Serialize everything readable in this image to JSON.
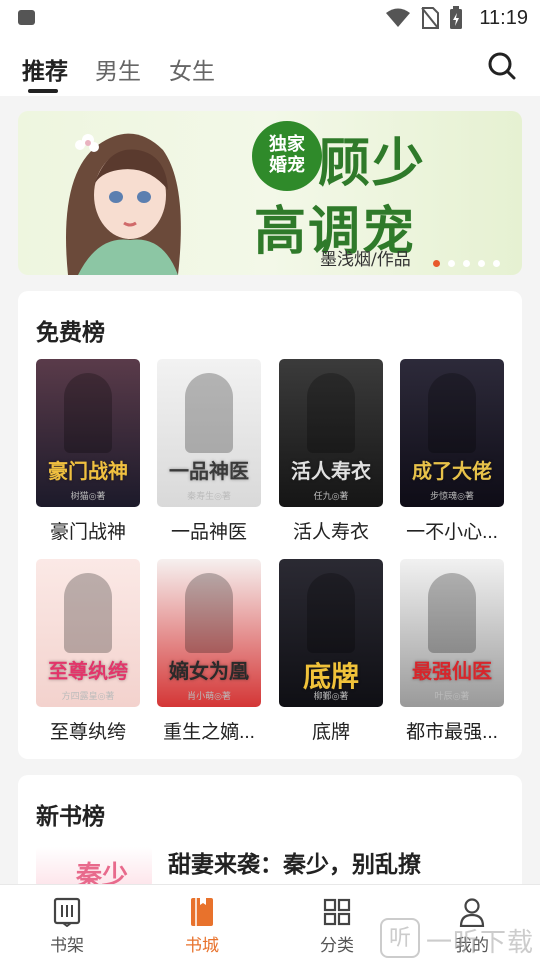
{
  "status_bar": {
    "time": "11:19"
  },
  "top_nav": {
    "tabs": [
      {
        "label": "推荐",
        "active": true
      },
      {
        "label": "男生",
        "active": false
      },
      {
        "label": "女生",
        "active": false
      }
    ]
  },
  "banner": {
    "badge": "独家\n婚宠",
    "title_line1": "顾少",
    "title_line2": "高调宠",
    "author": "墨浅烟/作品"
  },
  "free_rank": {
    "title": "免费榜",
    "books": [
      {
        "name": "豪门战神",
        "cover_text": "豪门战神",
        "cover_author": "树猫◎著",
        "colors": [
          "#5a3b4a",
          "#1c1a2a"
        ],
        "accent": "#f0c040"
      },
      {
        "name": "一品神医",
        "cover_text": "一品神医",
        "cover_author": "秦寿生◎著",
        "colors": [
          "#f2f2f2",
          "#d9d9d9"
        ],
        "accent": "#3a3a3a"
      },
      {
        "name": "活人寿衣",
        "cover_text": "活人寿衣",
        "cover_author": "任九◎著",
        "colors": [
          "#3b3b3b",
          "#151515"
        ],
        "accent": "#e0e0e0"
      },
      {
        "name": "一不小心...",
        "cover_text": "成了大佬",
        "cover_author": "步惊魂◎著",
        "colors": [
          "#2d2a3a",
          "#0e0c16"
        ],
        "accent": "#e8c24a"
      },
      {
        "name": "至尊纨绔",
        "cover_text": "至尊纨绔",
        "cover_author": "方四露皇◎著",
        "colors": [
          "#fbe9e6",
          "#f3d2cd"
        ],
        "accent": "#e2356a"
      },
      {
        "name": "重生之嫡...",
        "cover_text": "嫡女为凰",
        "cover_author": "肖小萌◎著",
        "colors": [
          "#f6f0ef",
          "#d43636"
        ],
        "accent": "#2a2a2a"
      },
      {
        "name": "底牌",
        "cover_text": "底牌",
        "cover_author": "柳鄞◎著",
        "colors": [
          "#2b2a33",
          "#0f0f14"
        ],
        "accent": "#f0c23a"
      },
      {
        "name": "都市最强...",
        "cover_text": "最强仙医",
        "cover_author": "叶辰◎著",
        "colors": [
          "#f1f1f1",
          "#9a9a9a"
        ],
        "accent": "#d7262b"
      }
    ]
  },
  "new_rank": {
    "title": "新书榜",
    "first_book": {
      "name": "甜妻来袭：秦少，别乱撩",
      "cover_text": "秦少"
    }
  },
  "bottom_nav": {
    "items": [
      {
        "label": "书架",
        "active": false
      },
      {
        "label": "书城",
        "active": true
      },
      {
        "label": "分类",
        "active": false
      },
      {
        "label": "我的",
        "active": false
      }
    ]
  },
  "watermark": {
    "text": "一听下载",
    "icon_text": "听"
  },
  "colors": {
    "accent": "#e8722c",
    "brand_green": "#2f7a2a"
  }
}
